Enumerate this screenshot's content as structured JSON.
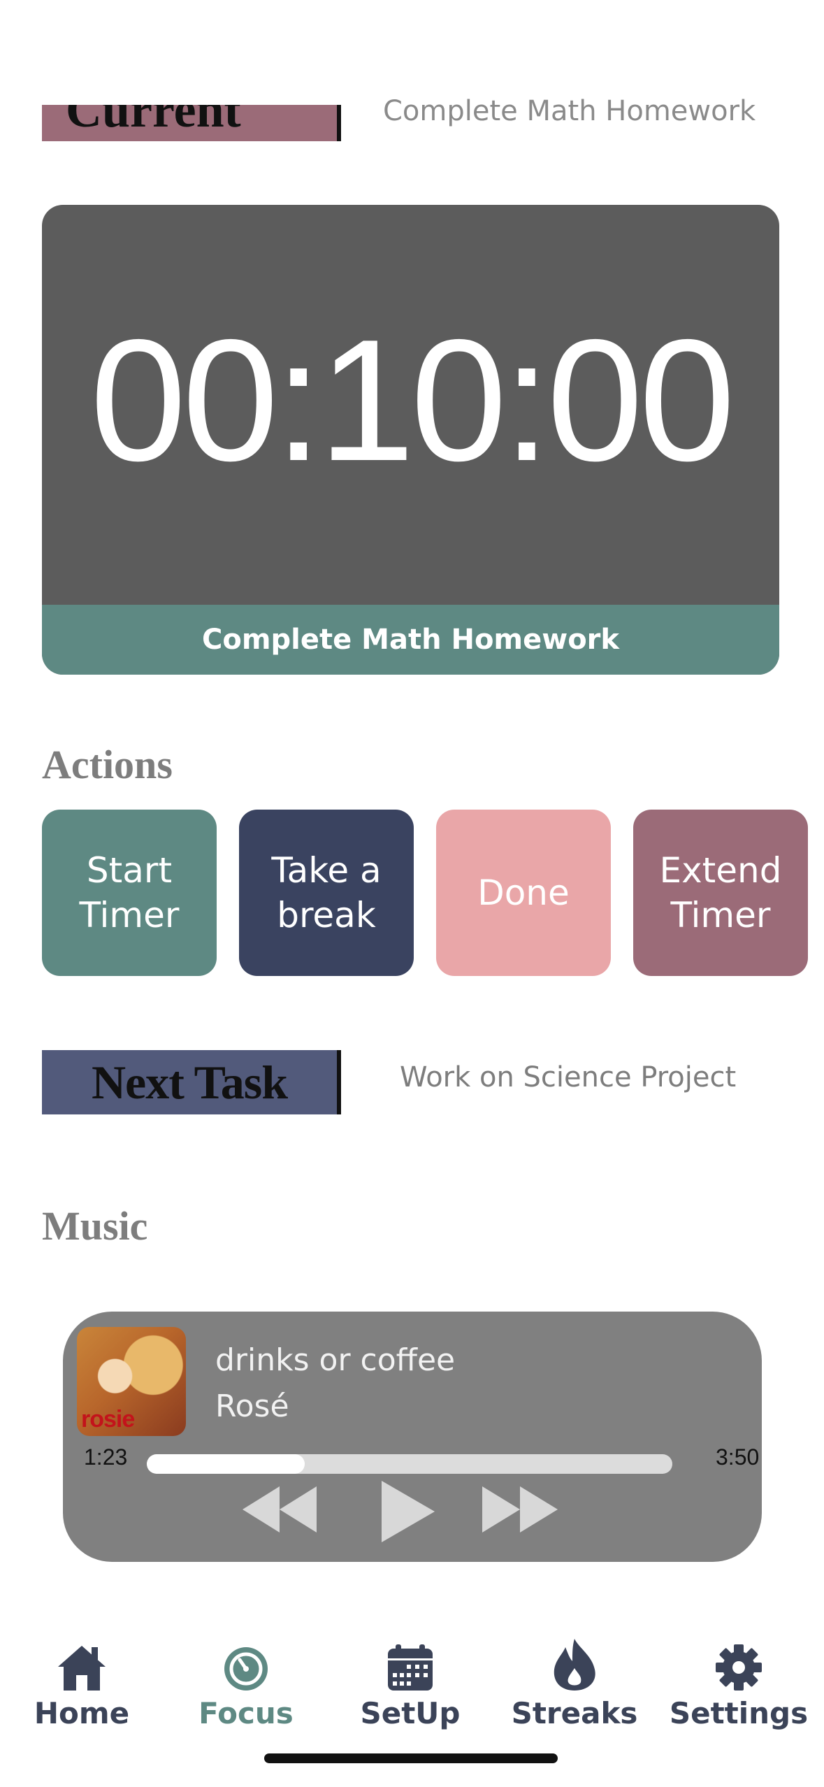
{
  "current_task": {
    "label": "Current Task",
    "name": "Complete Math Homework"
  },
  "timer": {
    "display": "00:10:00",
    "task": "Complete Math Homework"
  },
  "actions": {
    "title": "Actions",
    "buttons": [
      {
        "label": "Start\nTimer",
        "color": "#5e8983"
      },
      {
        "label": "Take a\nbreak",
        "color": "#3a4360"
      },
      {
        "label": "Done",
        "color": "#e9a6a8"
      },
      {
        "label": "Extend\nTimer",
        "color": "#9b6b78"
      }
    ]
  },
  "next_task": {
    "label": "Next Task",
    "name": "Work on Science Project"
  },
  "music": {
    "title": "Music",
    "song": "drinks or coffee",
    "artist": "Rosé",
    "album_text": "rosie",
    "current_time": "1:23",
    "total_time": "3:50",
    "progress_fraction": 0.3,
    "controls": [
      "rewind-icon",
      "play-icon",
      "fast-forward-icon"
    ]
  },
  "tabs": [
    {
      "label": "Home",
      "icon": "house-icon",
      "active": false
    },
    {
      "label": "Focus",
      "icon": "timer-icon",
      "active": true
    },
    {
      "label": "SetUp",
      "icon": "calendar-icon",
      "active": false
    },
    {
      "label": "Streaks",
      "icon": "flame-icon",
      "active": false
    },
    {
      "label": "Settings",
      "icon": "gear-icon",
      "active": false
    }
  ],
  "colors": {
    "accent": "#5e8983",
    "navy": "#3a4360",
    "tab_inactive": "#3b4358"
  }
}
